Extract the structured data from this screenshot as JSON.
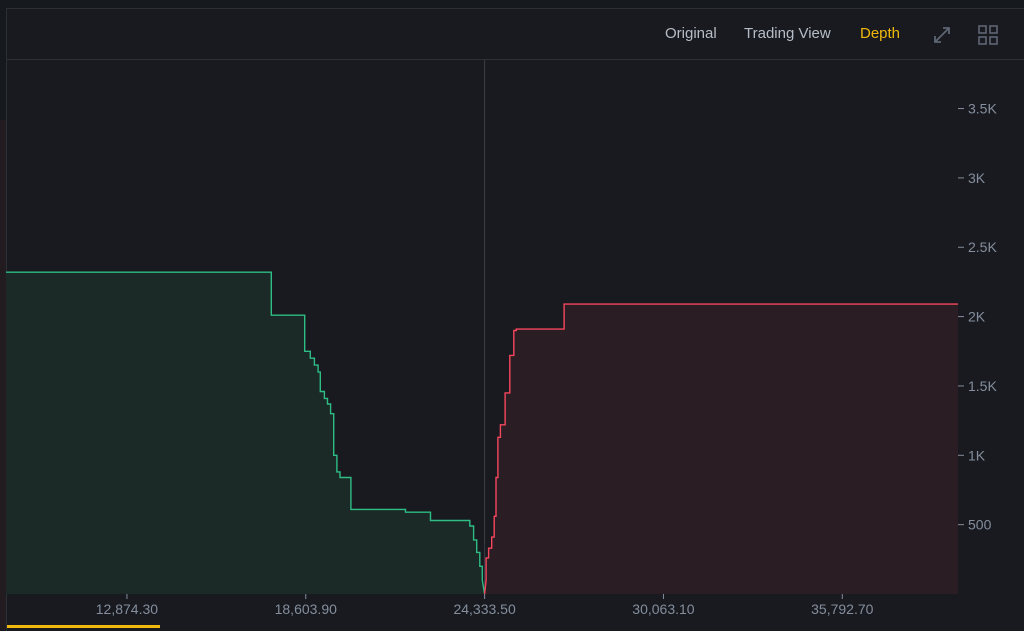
{
  "header": {
    "tabs": [
      {
        "label": "Original",
        "active": false
      },
      {
        "label": "Trading View",
        "active": false
      },
      {
        "label": "Depth",
        "active": true
      }
    ],
    "icons": [
      "expand-icon",
      "grid-layout-icon"
    ]
  },
  "colors": {
    "background": "#181a20",
    "bid_line": "#2ebd85",
    "bid_fill": "#1b2a27",
    "ask_line": "#f6465d",
    "ask_fill": "#2a1d23",
    "accent": "#f0b90b",
    "axis_text": "#848e9c"
  },
  "chart_data": {
    "type": "area",
    "mid_price": 24333.5,
    "x_ticks": [
      "12,874.30",
      "18,603.90",
      "24,333.50",
      "30,063.10",
      "35,792.70"
    ],
    "x_tick_values": [
      12874.3,
      18603.9,
      24333.5,
      30063.1,
      35792.7
    ],
    "y_ticks": [
      "500",
      "1K",
      "1.5K",
      "2K",
      "2.5K",
      "3K",
      "3.5K"
    ],
    "y_tick_values": [
      500,
      1000,
      1500,
      2000,
      2500,
      3000,
      3500
    ],
    "xlim": [
      9000,
      39500
    ],
    "ylim": [
      0,
      3850
    ],
    "grid": false,
    "series": [
      {
        "side": "bids",
        "points": [
          [
            9000,
            2320
          ],
          [
            17500,
            2320
          ],
          [
            17500,
            2010
          ],
          [
            18570,
            2010
          ],
          [
            18570,
            1750
          ],
          [
            18750,
            1750
          ],
          [
            18750,
            1700
          ],
          [
            18880,
            1700
          ],
          [
            18880,
            1650
          ],
          [
            19000,
            1650
          ],
          [
            19000,
            1600
          ],
          [
            19070,
            1600
          ],
          [
            19070,
            1460
          ],
          [
            19200,
            1460
          ],
          [
            19200,
            1410
          ],
          [
            19300,
            1410
          ],
          [
            19300,
            1370
          ],
          [
            19400,
            1370
          ],
          [
            19400,
            1300
          ],
          [
            19500,
            1300
          ],
          [
            19500,
            1000
          ],
          [
            19600,
            1000
          ],
          [
            19600,
            880
          ],
          [
            19700,
            880
          ],
          [
            19700,
            840
          ],
          [
            20050,
            840
          ],
          [
            20050,
            610
          ],
          [
            21800,
            610
          ],
          [
            21800,
            590
          ],
          [
            22600,
            590
          ],
          [
            22600,
            530
          ],
          [
            23860,
            530
          ],
          [
            23860,
            490
          ],
          [
            23980,
            490
          ],
          [
            23980,
            390
          ],
          [
            24080,
            390
          ],
          [
            24080,
            300
          ],
          [
            24180,
            300
          ],
          [
            24180,
            200
          ],
          [
            24260,
            200
          ],
          [
            24260,
            100
          ],
          [
            24333.5,
            0
          ]
        ]
      },
      {
        "side": "asks",
        "points": [
          [
            24333.5,
            0
          ],
          [
            24380,
            100
          ],
          [
            24380,
            260
          ],
          [
            24460,
            260
          ],
          [
            24460,
            330
          ],
          [
            24560,
            330
          ],
          [
            24560,
            410
          ],
          [
            24640,
            410
          ],
          [
            24640,
            560
          ],
          [
            24700,
            560
          ],
          [
            24700,
            840
          ],
          [
            24760,
            840
          ],
          [
            24760,
            1130
          ],
          [
            24840,
            1130
          ],
          [
            24840,
            1220
          ],
          [
            24990,
            1220
          ],
          [
            24990,
            1450
          ],
          [
            25140,
            1450
          ],
          [
            25140,
            1720
          ],
          [
            25270,
            1720
          ],
          [
            25270,
            1900
          ],
          [
            25350,
            1900
          ],
          [
            25350,
            1910
          ],
          [
            26880,
            1910
          ],
          [
            26880,
            2090
          ],
          [
            39500,
            2090
          ]
        ]
      }
    ]
  }
}
